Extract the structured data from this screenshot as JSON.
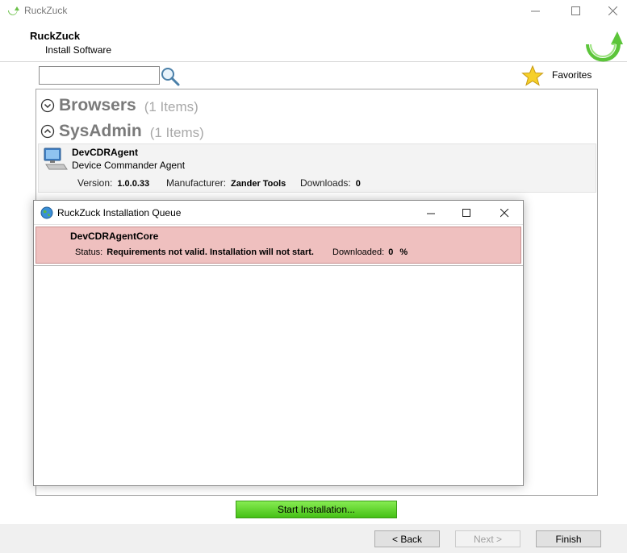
{
  "window": {
    "title": "RuckZuck",
    "controls": [
      "minimize",
      "maximize",
      "close"
    ]
  },
  "header": {
    "title": "RuckZuck",
    "subtitle": "Install Software"
  },
  "search": {
    "value": "",
    "placeholder": ""
  },
  "favorites_label": "Favorites",
  "groups": [
    {
      "name": "Browsers",
      "count": "(1 Items)",
      "state": "collapsed"
    },
    {
      "name": "SysAdmin",
      "count": "(1 Items)",
      "state": "expanded"
    }
  ],
  "software": {
    "name": "DevCDRAgent",
    "description": "Device Commander Agent",
    "version_label": "Version:",
    "version": "1.0.0.33",
    "manufacturer_label": "Manufacturer:",
    "manufacturer": "Zander Tools",
    "downloads_label": "Downloads:",
    "downloads": "0"
  },
  "start_button": "Start Installation...",
  "footer": {
    "back": "< Back",
    "next": "Next >",
    "finish": "Finish"
  },
  "queue_window": {
    "title": "RuckZuck Installation Queue",
    "item": {
      "name": "DevCDRAgentCore",
      "status_label": "Status:",
      "status": "Requirements not valid. Installation will not start.",
      "downloaded_label": "Downloaded:",
      "downloaded": "0",
      "percent_sign": "%",
      "state_color": "#efc0bf"
    }
  },
  "colors": {
    "accent_green": "#45c015",
    "error_bg": "#efc0bf"
  }
}
